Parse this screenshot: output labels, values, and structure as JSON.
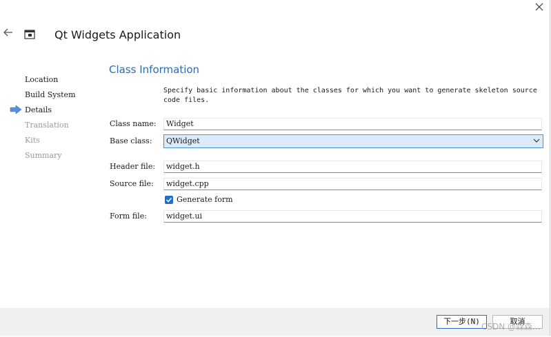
{
  "window": {
    "title": "Qt Widgets Application"
  },
  "steps": [
    {
      "label": "Location",
      "state": "done"
    },
    {
      "label": "Build System",
      "state": "done"
    },
    {
      "label": "Details",
      "state": "current"
    },
    {
      "label": "Translation",
      "state": "pending"
    },
    {
      "label": "Kits",
      "state": "pending"
    },
    {
      "label": "Summary",
      "state": "pending"
    }
  ],
  "page": {
    "title": "Class Information",
    "description_line1": "Specify basic information about the classes for which you want to generate skeleton source",
    "description_line2": "code files."
  },
  "form": {
    "class_name_label": "Class name:",
    "class_name_value": "Widget",
    "base_class_label": "Base class:",
    "base_class_value": "QWidget",
    "header_file_label": "Header file:",
    "header_file_value": "widget.h",
    "source_file_label": "Source file:",
    "source_file_value": "widget.cpp",
    "generate_form_label": "Generate form",
    "generate_form_checked": true,
    "form_file_label": "Form file:",
    "form_file_value": "widget.ui"
  },
  "buttons": {
    "next_label": "下一步(N)",
    "cancel_label": "取消"
  },
  "watermark": "CSDN @森森...",
  "colors": {
    "accent": "#2a6bb5",
    "checkbox": "#1f6fd1",
    "combo_bg": "#dcebfa",
    "step_arrow": "#5b8fd6"
  },
  "icons": {
    "close": "close-icon",
    "back": "back-arrow-icon",
    "wizard": "wizard-window-icon",
    "current_step": "current-step-arrow-icon",
    "dropdown": "chevron-down-icon",
    "check": "checkmark-icon"
  }
}
